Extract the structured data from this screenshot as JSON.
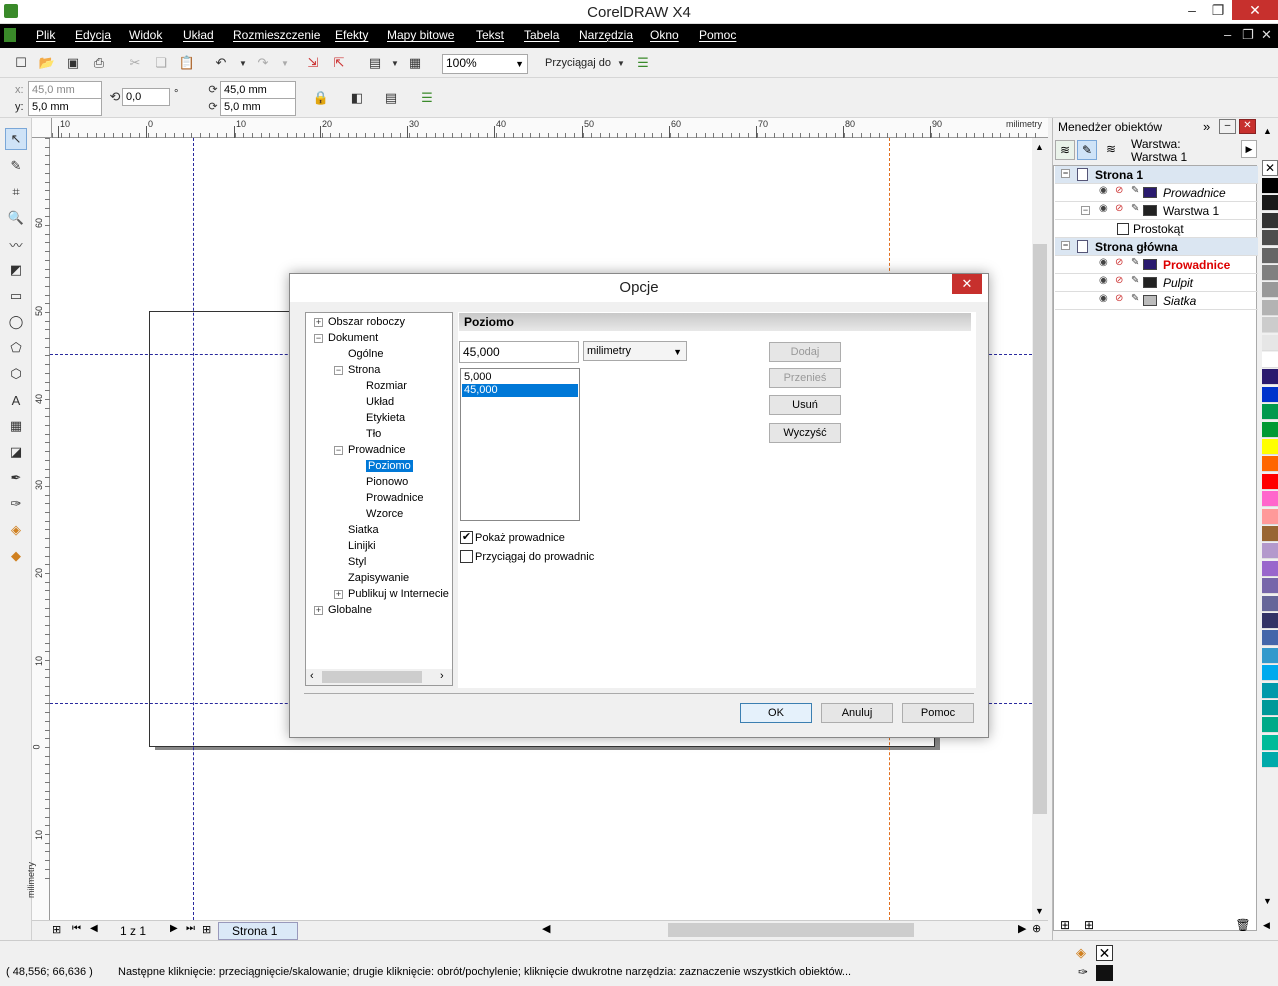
{
  "app": {
    "title": "CorelDRAW X4"
  },
  "menu": [
    "Plik",
    "Edycja",
    "Widok",
    "Układ",
    "Rozmieszczenie",
    "Efekty",
    "Mapy bitowe",
    "Tekst",
    "Tabela",
    "Narzędzia",
    "Okno",
    "Pomoc"
  ],
  "toolbar": {
    "zoom": "100%",
    "snap_label": "Przyciągaj do"
  },
  "props": {
    "x_label": "x:",
    "x_value": "45,0 mm",
    "y_label": "y:",
    "y_value": "5,0 mm",
    "angle": "0,0",
    "deg": "°",
    "w_value": "45,0 mm",
    "h_value": "5,0 mm"
  },
  "ruler": {
    "h_ticks": [
      "10",
      "0",
      "10",
      "20",
      "30",
      "40",
      "50",
      "60",
      "70",
      "80",
      "90"
    ],
    "unit": "milimetry",
    "v_ticks": [
      "60",
      "50",
      "40",
      "30",
      "20",
      "10",
      "0",
      "10"
    ]
  },
  "page_nav": {
    "count": "1 z 1",
    "tab": "Strona 1"
  },
  "docker": {
    "title": "Menedżer obiektów",
    "layer_label": "Warstwa:",
    "layer_value": "Warstwa 1",
    "rows": [
      {
        "label": "Strona 1",
        "kind": "page"
      },
      {
        "label": "Prowadnice",
        "kind": "guides",
        "color": "#2a1a6e"
      },
      {
        "label": "Warstwa 1",
        "kind": "layer",
        "color": "#222222"
      },
      {
        "label": "Prostokąt",
        "kind": "object"
      },
      {
        "label": "Strona główna",
        "kind": "page"
      },
      {
        "label": "Prowadnice",
        "kind": "guides-master",
        "color": "#2a1a6e"
      },
      {
        "label": "Pulpit",
        "kind": "desktop",
        "color": "#222222"
      },
      {
        "label": "Siatka",
        "kind": "grid",
        "color": "#bbbbbb"
      }
    ]
  },
  "palette": [
    "#000000",
    "#1a1a1a",
    "#333333",
    "#4d4d4d",
    "#666666",
    "#808080",
    "#999999",
    "#b3b3b3",
    "#cccccc",
    "#e6e6e6",
    "#ffffff",
    "#2a1a6e",
    "#0033cc",
    "#00994d",
    "#009933",
    "#ffff00",
    "#ff6600",
    "#ff0000",
    "#ff66cc",
    "#ff9999",
    "#996633",
    "#b399cc",
    "#9966cc",
    "#7766aa",
    "#666699",
    "#333366",
    "#4466aa",
    "#3399cc",
    "#00aaee",
    "#0099aa",
    "#009999",
    "#00aa88",
    "#00bb99",
    "#00aaaa"
  ],
  "status": {
    "coords": "( 48,556; 66,636 )",
    "hint": "Następne kliknięcie: przeciągnięcie/skalowanie; drugie kliknięcie: obrót/pochylenie; kliknięcie dwukrotne narzędzia: zaznaczenie wszystkich obiektów..."
  },
  "dialog": {
    "title": "Opcje",
    "tree": [
      {
        "label": "Obszar roboczy",
        "level": 0,
        "box": "+"
      },
      {
        "label": "Dokument",
        "level": 0,
        "box": "−"
      },
      {
        "label": "Ogólne",
        "level": 1
      },
      {
        "label": "Strona",
        "level": 1,
        "box": "−"
      },
      {
        "label": "Rozmiar",
        "level": 2
      },
      {
        "label": "Układ",
        "level": 2
      },
      {
        "label": "Etykieta",
        "level": 2
      },
      {
        "label": "Tło",
        "level": 2
      },
      {
        "label": "Prowadnice",
        "level": 1,
        "box": "−"
      },
      {
        "label": "Poziomo",
        "level": 2,
        "selected": true
      },
      {
        "label": "Pionowo",
        "level": 2
      },
      {
        "label": "Prowadnice",
        "level": 2
      },
      {
        "label": "Wzorce",
        "level": 2
      },
      {
        "label": "Siatka",
        "level": 1
      },
      {
        "label": "Linijki",
        "level": 1
      },
      {
        "label": "Styl",
        "level": 1
      },
      {
        "label": "Zapisywanie",
        "level": 1
      },
      {
        "label": "Publikuj w Internecie",
        "level": 1,
        "box": "+"
      },
      {
        "label": "Globalne",
        "level": 0,
        "box": "+"
      }
    ],
    "panel_title": "Poziomo",
    "value": "45,000",
    "unit": "milimetry",
    "list": [
      {
        "label": "5,000"
      },
      {
        "label": "45,000",
        "selected": true
      }
    ],
    "buttons": {
      "add": "Dodaj",
      "move": "Przenieś",
      "delete": "Usuń",
      "clear": "Wyczyść"
    },
    "show_guides": "Pokaż prowadnice",
    "show_guides_checked": true,
    "snap_guides": "Przyciągaj do prowadnic",
    "snap_guides_checked": false,
    "ok": "OK",
    "cancel": "Anuluj",
    "help": "Pomoc"
  }
}
